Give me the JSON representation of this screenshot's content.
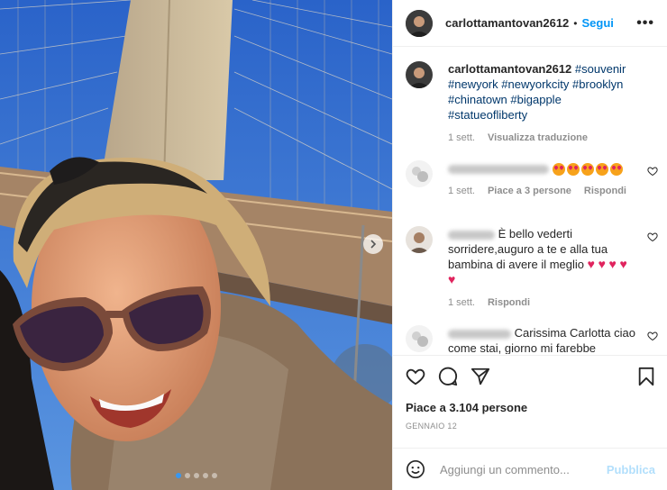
{
  "post": {
    "author": "carlottamantovan2612",
    "follow_label": "Segui",
    "bullet": "•",
    "more_label": "•••",
    "carousel": {
      "total": 5,
      "active": 1
    }
  },
  "caption": {
    "username": "carlottamantovan2612",
    "hashtags": [
      "#souvenir",
      "#newyork",
      "#newyorkcity",
      "#brooklyn",
      "#chinatown",
      "#bigapple",
      "#statueofliberty"
    ],
    "time": "1 sett.",
    "translate_label": "Visualizza traduzione"
  },
  "comments": [
    {
      "text_prefix": "",
      "time": "1 sett.",
      "likes_label": "Piace a 3 persone",
      "reply_label": "Rispondi",
      "emoji_count": 5
    },
    {
      "text": "È bello vederti sorridere,auguro a te e alla tua bambina di avere il meglio",
      "time": "1 sett.",
      "reply_label": "Rispondi",
      "heart_count": 5
    },
    {
      "text": "Carissima Carlotta ciao come stai, giorno mi farebbe"
    }
  ],
  "actions": {
    "likes_text": "Piace a 3.104 persone",
    "date": "GENNAIO 12"
  },
  "add_comment": {
    "placeholder": "Aggiungi un commento...",
    "publish_label": "Pubblica"
  },
  "colors": {
    "accent": "#0095f6",
    "publish_disabled": "#b2dffc",
    "hashtag": "#00376b",
    "meta": "#8e8e8e",
    "heart_red": "#e0245e"
  }
}
